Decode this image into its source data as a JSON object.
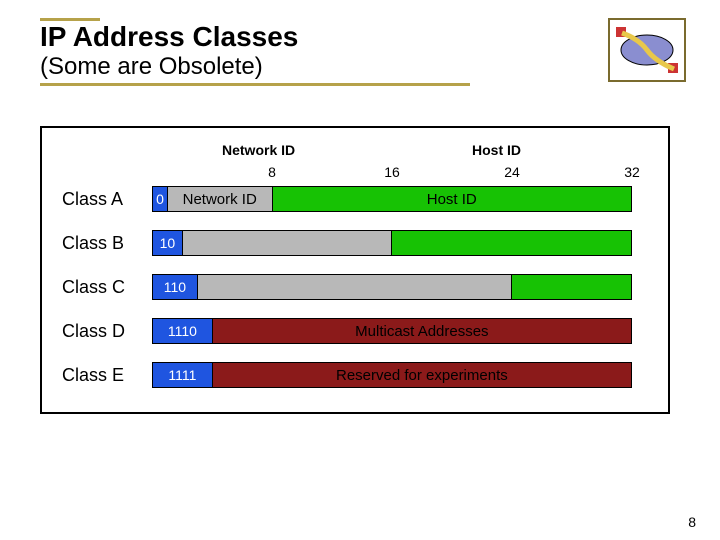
{
  "title": "IP Address Classes",
  "subtitle": "(Some are Obsolete)",
  "header_labels": {
    "net": "Network ID",
    "host": "Host ID"
  },
  "bits": {
    "b8": "8",
    "b16": "16",
    "b24": "24",
    "b32": "32"
  },
  "rows": {
    "a": {
      "label": "Class A",
      "prefix": "0",
      "net": "Network ID",
      "host": "Host ID"
    },
    "b": {
      "label": "Class B",
      "prefix": "10"
    },
    "c": {
      "label": "Class C",
      "prefix": "110"
    },
    "d": {
      "label": "Class D",
      "prefix": "1110",
      "text": "Multicast Addresses"
    },
    "e": {
      "label": "Class E",
      "prefix": "1111",
      "text": "Reserved for experiments"
    }
  },
  "page_number": "8"
}
